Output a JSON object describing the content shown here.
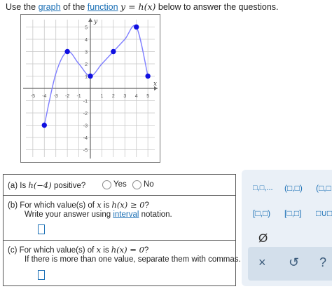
{
  "instruction": {
    "before_graph": "Use the ",
    "graph_link": "graph",
    "middle": " of the ",
    "function_link": "function",
    "equation": "y = h(x)",
    "after": " below to answer the questions."
  },
  "chart_data": {
    "type": "line",
    "xlabel": "x",
    "ylabel": "y",
    "xlim": [
      -5,
      5
    ],
    "ylim": [
      -5,
      5
    ],
    "grid": true,
    "x_ticks": [
      "-5",
      "-4",
      "-3",
      "-2",
      "-1",
      "1",
      "2",
      "3",
      "4",
      "5"
    ],
    "y_ticks": [
      "5",
      "4",
      "3",
      "2",
      "1",
      "-1",
      "-2",
      "-3",
      "-4",
      "-5"
    ],
    "points": [
      {
        "x": -4,
        "y": -3,
        "closed": true
      },
      {
        "x": -2,
        "y": 3,
        "closed": true
      },
      {
        "x": 0,
        "y": 1,
        "closed": true
      },
      {
        "x": 2,
        "y": 3,
        "closed": true
      },
      {
        "x": 4,
        "y": 5,
        "closed": true
      },
      {
        "x": 5,
        "y": 1,
        "closed": true
      }
    ],
    "curve": [
      [
        -4,
        -3
      ],
      [
        -3,
        1.2
      ],
      [
        -2,
        3
      ],
      [
        -1,
        2
      ],
      [
        0,
        1
      ],
      [
        1,
        2
      ],
      [
        2,
        3
      ],
      [
        3,
        4
      ],
      [
        4,
        5
      ],
      [
        5,
        1
      ]
    ]
  },
  "questions": {
    "a": {
      "label": "(a)",
      "text_before": "Is ",
      "expr": "h(−4)",
      "text_after": " positive?",
      "options": [
        "Yes",
        "No"
      ]
    },
    "b": {
      "label": "(b)",
      "line1_before": "For which value(s) of ",
      "var": "x",
      "line1_mid": " is ",
      "expr": "h(x) ≥ 0",
      "line1_after": "?",
      "line2_before": "Write your answer using ",
      "line2_link": "interval",
      "line2_after": " notation."
    },
    "c": {
      "label": "(c)",
      "line1_before": "For which value(s) of ",
      "var": "x",
      "line1_mid": " is ",
      "expr": "h(x) = 0",
      "line1_after": "?",
      "line2": "If there is more than one value, separate them with commas."
    }
  },
  "palette": {
    "row1": [
      "□,□,...",
      "(□,□)",
      "(□,□"
    ],
    "row2": [
      "[□,□)",
      "[□,□]",
      "□∪□"
    ],
    "empty_set": "Ø",
    "clear": "×",
    "undo": "↺",
    "help": "?"
  },
  "colors": {
    "point": "#1010e0",
    "curve": "#7f7fff",
    "link": "#1a6fb5",
    "grid": "#c8c8c8"
  }
}
